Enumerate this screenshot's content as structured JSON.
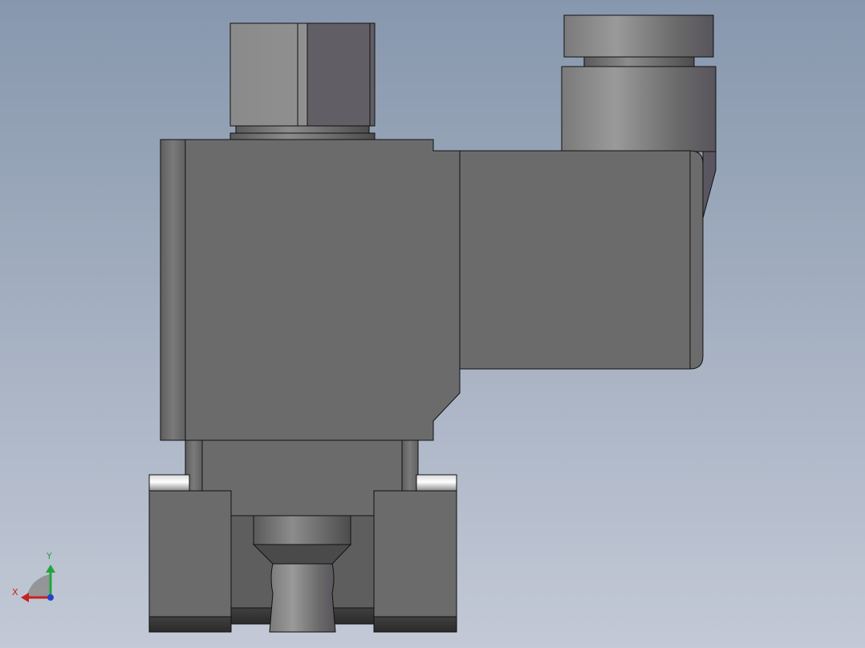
{
  "viewport": {
    "background_top": "#8797ad",
    "background_bottom": "#c3c9d6",
    "body_color": "#6b6b6b",
    "edge_color": "#111111"
  },
  "triad": {
    "x_label": "X",
    "y_label": "Y",
    "x_color": "#cc1f1f",
    "y_color": "#1fa63a",
    "z_color": "#2244cc"
  }
}
